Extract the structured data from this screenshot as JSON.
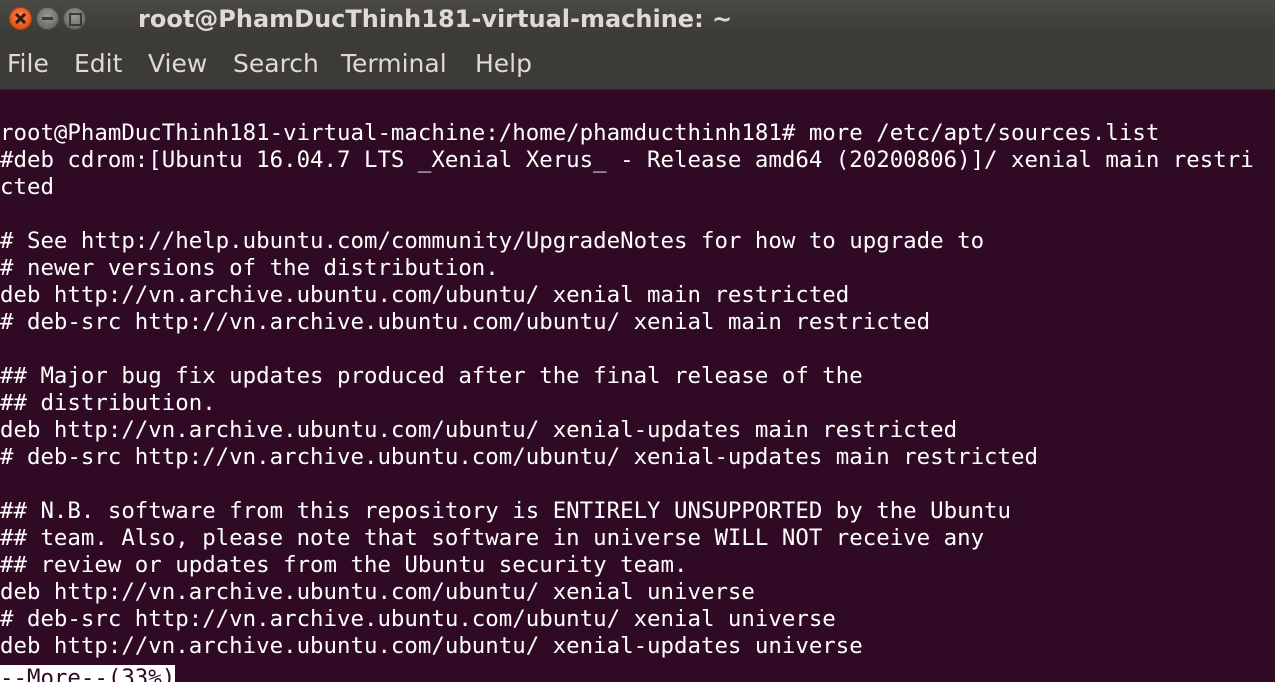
{
  "window": {
    "title": "root@PhamDucThinh181-virtual-machine: ~"
  },
  "menu": {
    "file": "File",
    "edit": "Edit",
    "view": "View",
    "search": "Search",
    "terminal": "Terminal",
    "help": "Help"
  },
  "terminal": {
    "lines": [
      "root@PhamDucThinh181-virtual-machine:/home/phamducthinh181# more /etc/apt/sources.list",
      "#deb cdrom:[Ubuntu 16.04.7 LTS _Xenial Xerus_ - Release amd64 (20200806)]/ xenial main restri",
      "cted",
      "",
      "# See http://help.ubuntu.com/community/UpgradeNotes for how to upgrade to",
      "# newer versions of the distribution.",
      "deb http://vn.archive.ubuntu.com/ubuntu/ xenial main restricted",
      "# deb-src http://vn.archive.ubuntu.com/ubuntu/ xenial main restricted",
      "",
      "## Major bug fix updates produced after the final release of the",
      "## distribution.",
      "deb http://vn.archive.ubuntu.com/ubuntu/ xenial-updates main restricted",
      "# deb-src http://vn.archive.ubuntu.com/ubuntu/ xenial-updates main restricted",
      "",
      "## N.B. software from this repository is ENTIRELY UNSUPPORTED by the Ubuntu",
      "## team. Also, please note that software in universe WILL NOT receive any",
      "## review or updates from the Ubuntu security team.",
      "deb http://vn.archive.ubuntu.com/ubuntu/ xenial universe",
      "# deb-src http://vn.archive.ubuntu.com/ubuntu/ xenial universe",
      "deb http://vn.archive.ubuntu.com/ubuntu/ xenial-updates universe"
    ],
    "more_prompt": "--More--(33%)"
  },
  "colors": {
    "terminal_background": "#300a24",
    "terminal_text": "#ffffff",
    "menubar_background": "#3c3b37",
    "close_button": "#e25516"
  },
  "icons": [
    "close-icon",
    "minimize-icon",
    "maximize-icon"
  ]
}
